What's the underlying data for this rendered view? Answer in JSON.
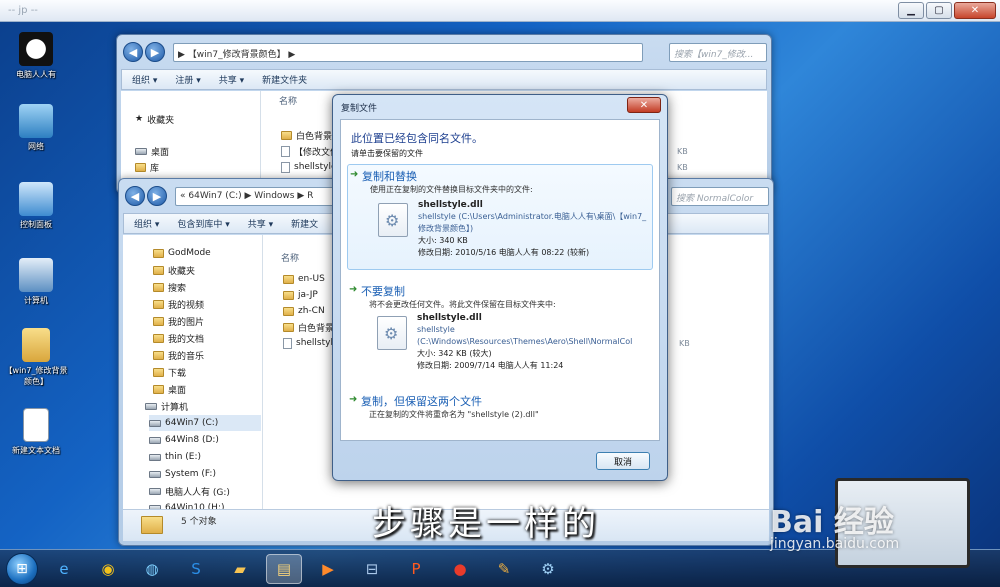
{
  "player": {
    "title": "-- jp --"
  },
  "desktop_icons": [
    {
      "label": "电脑人人有"
    },
    {
      "label": "网络"
    },
    {
      "label": "控制面板"
    },
    {
      "label": "计算机"
    },
    {
      "label": "【win7_修改背景颜色】"
    },
    {
      "label": "新建文本文档"
    }
  ],
  "back_window": {
    "address": "▶ 【win7_修改背景颜色】 ▶",
    "search_placeholder": "搜索【win7_修改...",
    "toolbar": [
      "组织 ▾",
      "注册 ▾",
      "共享 ▾",
      "新建文件夹"
    ],
    "nav": [
      "收藏夹",
      "桌面",
      "库"
    ],
    "col_name": "名称",
    "files": [
      "白色背景",
      "【修改文件",
      "shellstyle"
    ],
    "sizes": [
      "KB",
      "KB"
    ]
  },
  "front_window": {
    "address": "« 64Win7 (C:) ▶ Windows ▶ R",
    "search_placeholder": "搜索 NormalColor",
    "toolbar": [
      "组织 ▾",
      "包含到库中 ▾",
      "共享 ▾",
      "新建文"
    ],
    "nav": [
      "GodMode",
      "收藏夹",
      "搜索",
      "我的视频",
      "我的图片",
      "我的文档",
      "我的音乐",
      "下载",
      "桌面",
      "计算机",
      "64Win7 (C:)",
      "64Win8 (D:)",
      "thin (E:)",
      "System (F:)",
      "电脑人人有 (G:)",
      "64Win10 (H:)"
    ],
    "col_name": "名称",
    "files": [
      "en-US",
      "ja-JP",
      "zh-CN",
      "白色背景",
      "shellstyle"
    ],
    "size": "KB",
    "status": "5 个对象"
  },
  "dialog": {
    "title": "复制文件",
    "close_label": "✕",
    "heading": "此位置已经包含同名文件。",
    "sub": "请单击要保留的文件",
    "option1": {
      "title": "复制和替换",
      "desc": "使用正在复制的文件替换目标文件夹中的文件:",
      "file_name": "shellstyle.dll",
      "path": "shellstyle (C:\\Users\\Administrator.电脑人人有\\桌面\\【win7_修改背景颜色】)",
      "size": "大小: 340 KB",
      "modified": "修改日期: 2010/5/16 电脑人人有 08:22 (较新)"
    },
    "option2": {
      "title": "不要复制",
      "desc": "将不会更改任何文件。将此文件保留在目标文件夹中:",
      "file_name": "shellstyle.dll",
      "path_a": "shellstyle",
      "path_b": "(C:\\Windows\\Resources\\Themes\\Aero\\Shell\\NormalCol",
      "size": "大小: 342 KB (较大)",
      "modified": "修改日期: 2009/7/14 电脑人人有 11:24"
    },
    "option3": {
      "title": "复制，但保留这两个文件",
      "desc": "正在复制的文件将重命名为 \"shellstyle (2).dll\""
    },
    "cancel": "取消"
  },
  "caption": "步骤是一样的",
  "watermark": {
    "brand": "Bai 经验",
    "url": "jingyan.baidu.com"
  },
  "colors": {
    "accent": "#1a5fb4",
    "desktop": "#1463c4"
  }
}
